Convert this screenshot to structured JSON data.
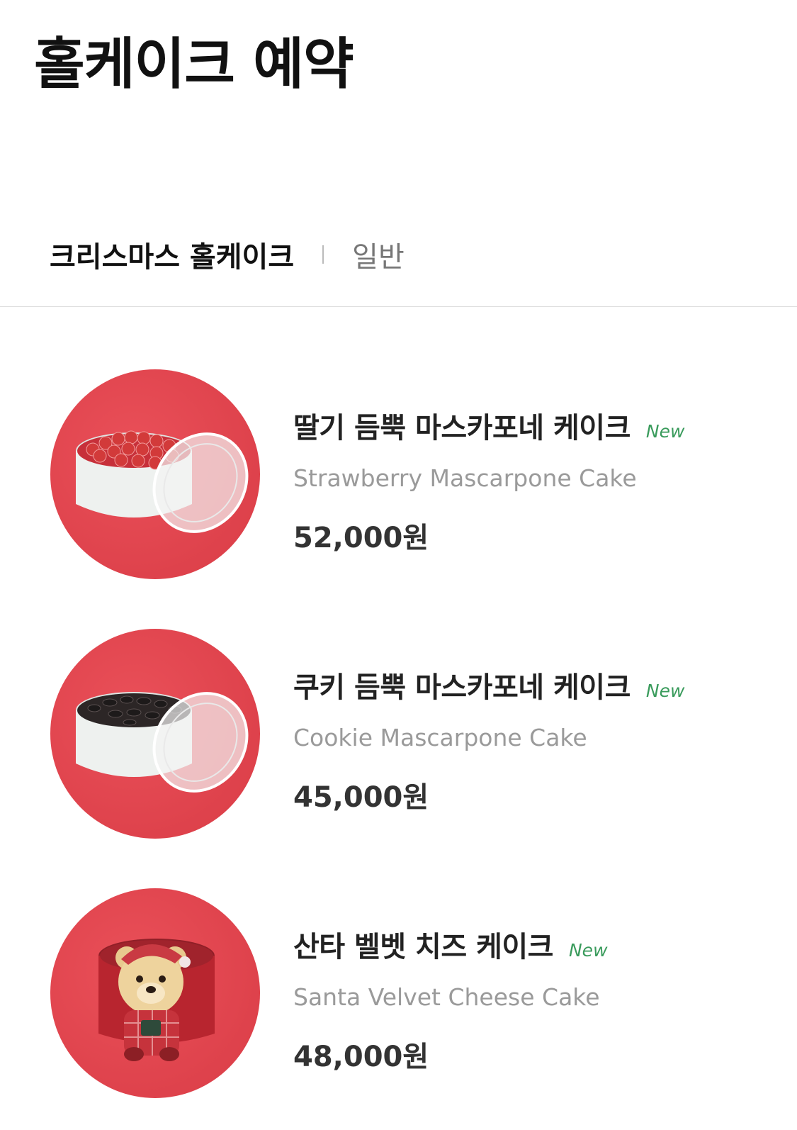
{
  "header": {
    "title": "홀케이크 예약"
  },
  "tabs": [
    {
      "label": "크리스마스 홀케이크",
      "active": true
    },
    {
      "label": "일반",
      "active": false
    }
  ],
  "products": [
    {
      "name_ko": "딸기 듬뿍 마스카포네 케이크",
      "badge": "New",
      "name_en": "Strawberry Mascarpone Cake",
      "price": "52,000원",
      "image": "strawberry-cake-image"
    },
    {
      "name_ko": "쿠키 듬뿍 마스카포네 케이크",
      "badge": "New",
      "name_en": "Cookie Mascarpone Cake",
      "price": "45,000원",
      "image": "cookie-cake-image"
    },
    {
      "name_ko": "산타 벨벳 치즈 케이크",
      "badge": "New",
      "name_en": "Santa Velvet Cheese Cake",
      "price": "48,000원",
      "image": "santa-bear-cake-image"
    }
  ],
  "colors": {
    "thumbnail_bg": "#e04852",
    "badge": "#3a9b5c",
    "english_name": "#9a9a9a"
  }
}
